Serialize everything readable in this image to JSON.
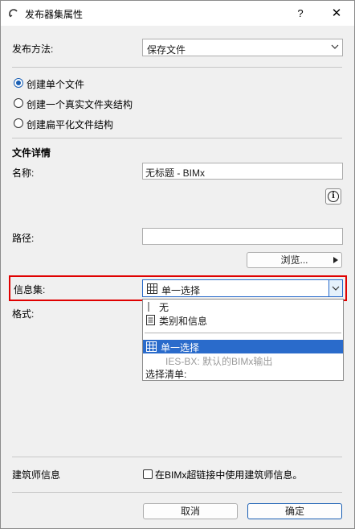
{
  "window": {
    "title": "发布器集属性",
    "help_label": "?",
    "close_label": "✕"
  },
  "publish_method": {
    "label": "发布方法:",
    "value": "保存文件"
  },
  "radio_options": [
    {
      "label": "创建单个文件",
      "selected": true
    },
    {
      "label": "创建一个真实文件夹结构",
      "selected": false
    },
    {
      "label": "创建扁平化文件结构",
      "selected": false
    }
  ],
  "file_details": {
    "heading": "文件详情",
    "name_label": "名称:",
    "name_value": "无标题 - BIMx",
    "info_glyph": "i",
    "path_label": "路径:",
    "path_value": "",
    "browse_label": "浏览..."
  },
  "info_set": {
    "label": "信息集:",
    "value": "单一选择",
    "format_label": "格式:",
    "options": [
      {
        "label": "无",
        "icon": "text-cursor-icon",
        "state": "normal"
      },
      {
        "label": "类别和信息",
        "icon": "document-icon",
        "state": "normal"
      },
      {
        "label": "单一选择",
        "icon": "grid-icon",
        "state": "selected"
      },
      {
        "label": "IES-BX: 默认的BIMx输出",
        "icon": "",
        "state": "disabled"
      },
      {
        "label": "选择清单:",
        "icon": "",
        "state": "normal"
      }
    ]
  },
  "architect": {
    "label": "建筑师信息",
    "checkbox_label": "在BIMx超链接中使用建筑师信息。",
    "checked": false
  },
  "footer": {
    "cancel_label": "取消",
    "ok_label": "确定"
  },
  "colors": {
    "accent": "#2a6bcb",
    "highlight_border": "#e00000"
  }
}
